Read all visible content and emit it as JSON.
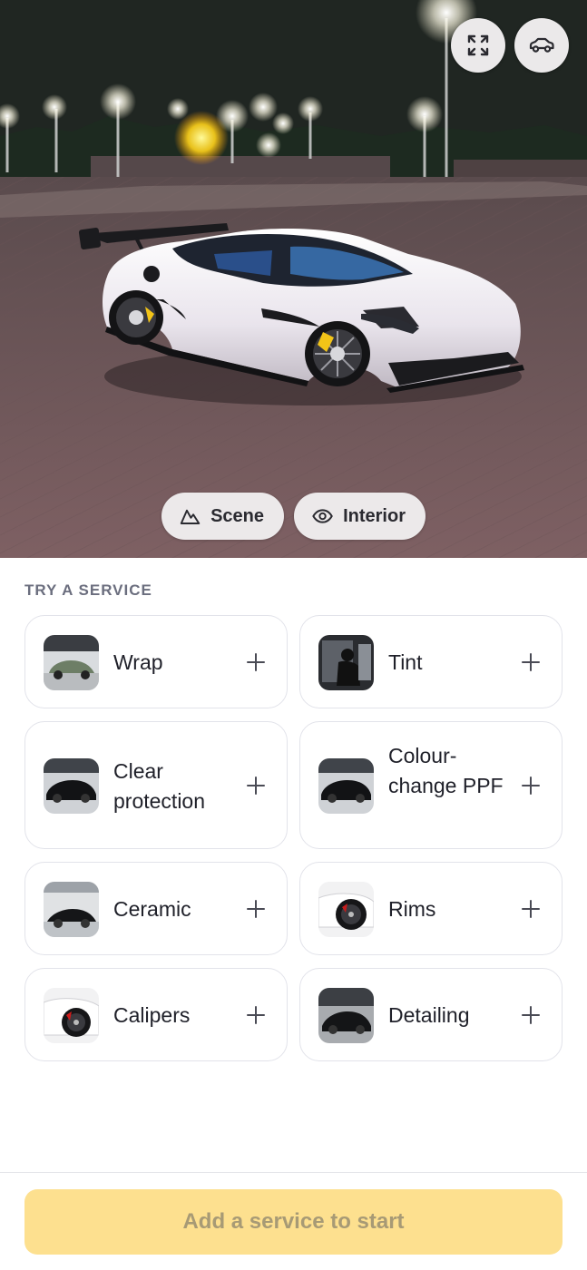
{
  "viewer": {
    "expand_icon": "expand-arrows-icon",
    "car_icon": "car-outline-icon",
    "scene_label": "Scene",
    "scene_icon": "mountain-icon",
    "interior_label": "Interior",
    "interior_icon": "eye-icon"
  },
  "services": {
    "section_title": "TRY A SERVICE",
    "items": [
      {
        "label": "Wrap",
        "thumb": "green-car-photo"
      },
      {
        "label": "Tint",
        "thumb": "tint-install-photo"
      },
      {
        "label": "Clear protection",
        "thumb": "black-car-photo"
      },
      {
        "label": "Colour-change PPF",
        "thumb": "black-car-photo"
      },
      {
        "label": "Ceramic",
        "thumb": "black-car-garage-photo"
      },
      {
        "label": "Rims",
        "thumb": "white-car-rim-photo"
      },
      {
        "label": "Calipers",
        "thumb": "red-caliper-photo"
      },
      {
        "label": "Detailing",
        "thumb": "black-car-detailing-photo"
      }
    ]
  },
  "footer": {
    "cta_label": "Add a service to start"
  },
  "colors": {
    "cta_background": "#fde08f",
    "cta_text": "#a79a75",
    "card_border": "#e2e3ea",
    "section_title": "#6b6e7e"
  }
}
